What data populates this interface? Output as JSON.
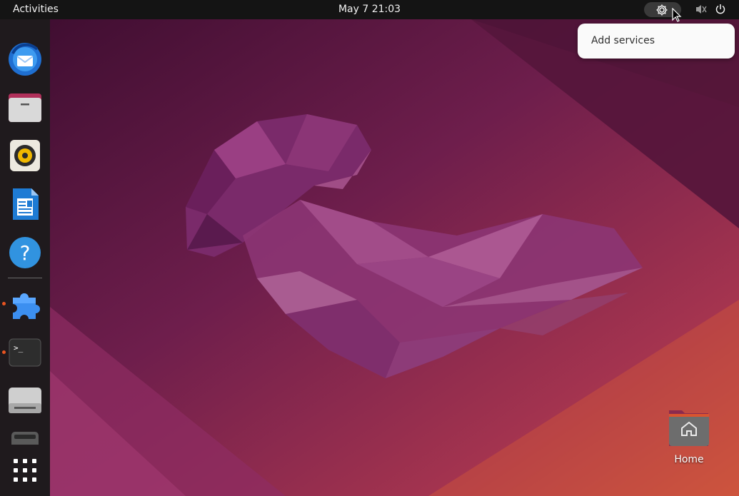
{
  "topbar": {
    "activities_label": "Activities",
    "clock": "May 7  21:03",
    "status_icon": "gear-icon",
    "volume_icon": "volume-muted-icon",
    "power_icon": "power-icon"
  },
  "popup": {
    "item_label": "Add services"
  },
  "dock": {
    "apps": [
      {
        "name": "thunderbird",
        "icon": "thunderbird-icon",
        "running": false
      },
      {
        "name": "files",
        "icon": "files-icon",
        "running": false
      },
      {
        "name": "rhythmbox",
        "icon": "rhythmbox-icon",
        "running": false
      },
      {
        "name": "libreoffice-writer",
        "icon": "writer-icon",
        "running": false
      },
      {
        "name": "help",
        "icon": "help-icon",
        "running": false
      },
      {
        "name": "extension",
        "icon": "puzzle-icon",
        "running": true
      },
      {
        "name": "terminal",
        "icon": "terminal-icon",
        "running": true
      },
      {
        "name": "disk",
        "icon": "drive-icon",
        "running": false
      },
      {
        "name": "removable-drive",
        "icon": "usb-drive-icon",
        "running": false
      }
    ],
    "show_apps_icon": "app-grid-icon"
  },
  "desktop": {
    "home_label": "Home",
    "home_icon": "home-folder-icon"
  },
  "colors": {
    "accent": "#e95420",
    "wallpaper_dark": "#3a0f2e",
    "wallpaper_light": "#c24448"
  }
}
